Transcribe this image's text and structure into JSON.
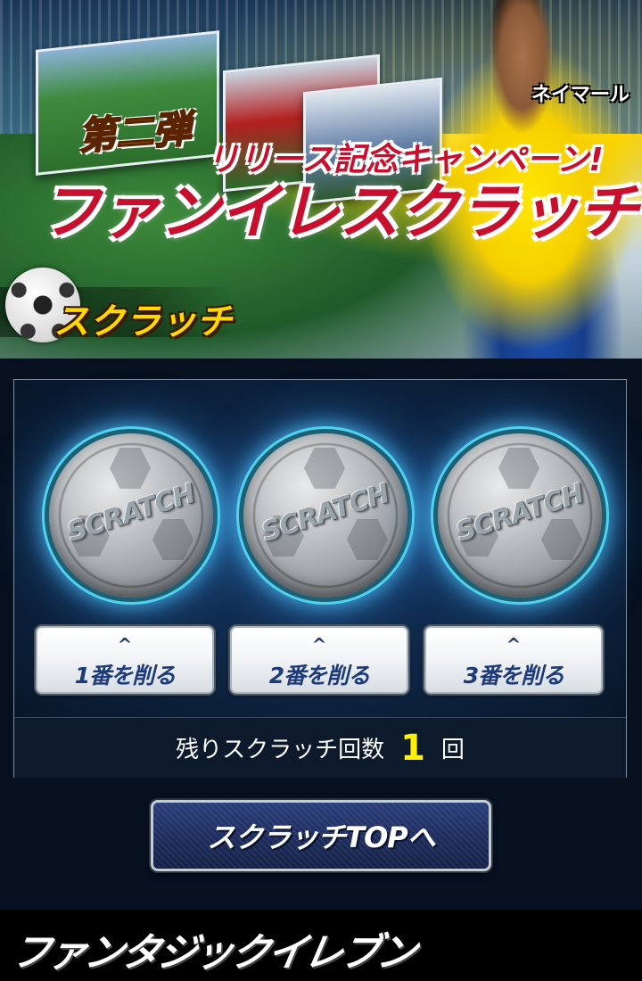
{
  "banner": {
    "phase": "第二弾",
    "campaign": "リリース記念キャンペーン!",
    "title": "ファンイレスクラッチ",
    "player_name": "ネイマール",
    "section_label": "スクラッチ"
  },
  "scratch": {
    "coins": [
      {
        "label": "SCRATCH"
      },
      {
        "label": "SCRATCH"
      },
      {
        "label": "SCRATCH"
      }
    ],
    "buttons": [
      {
        "chevron": "^",
        "label": "1番を削る"
      },
      {
        "chevron": "^",
        "label": "2番を削る"
      },
      {
        "chevron": "^",
        "label": "3番を削る"
      }
    ],
    "remaining": {
      "prefix": "残りスクラッチ回数",
      "count": "1",
      "suffix": "回"
    }
  },
  "top_button": {
    "label": "スクラッチTOPへ"
  },
  "footer": {
    "logo": "ファンタジックイレブン"
  },
  "colors": {
    "background": "#06101f",
    "accent_red": "#c8102e",
    "accent_yellow": "#ffd800",
    "count_yellow": "#fff200",
    "button_text": "#1c3b78"
  }
}
